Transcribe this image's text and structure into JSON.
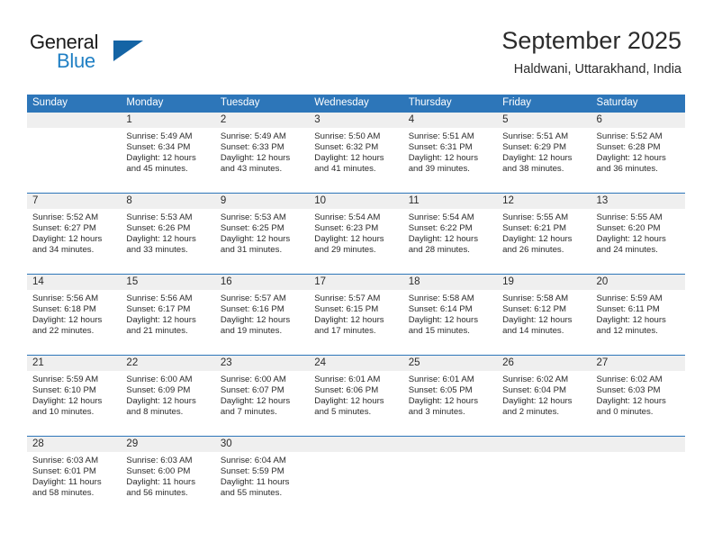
{
  "brand": {
    "name_part1": "General",
    "name_part2": "Blue",
    "flag_icon": "triangle-flag-icon"
  },
  "header": {
    "title": "September 2025",
    "subtitle": "Haldwani, Uttarakhand, India"
  },
  "theme": {
    "header_blue": "#2d76b9",
    "brand_blue": "#1f7fc4",
    "flag_blue": "#1464a5",
    "day_band_grey": "#efefef",
    "text": "#2b2b2b"
  },
  "weekdays": [
    "Sunday",
    "Monday",
    "Tuesday",
    "Wednesday",
    "Thursday",
    "Friday",
    "Saturday"
  ],
  "weeks": [
    [
      {
        "day": "",
        "empty": true
      },
      {
        "day": "1",
        "sunrise": "Sunrise: 5:49 AM",
        "sunset": "Sunset: 6:34 PM",
        "daylight": "Daylight: 12 hours and 45 minutes."
      },
      {
        "day": "2",
        "sunrise": "Sunrise: 5:49 AM",
        "sunset": "Sunset: 6:33 PM",
        "daylight": "Daylight: 12 hours and 43 minutes."
      },
      {
        "day": "3",
        "sunrise": "Sunrise: 5:50 AM",
        "sunset": "Sunset: 6:32 PM",
        "daylight": "Daylight: 12 hours and 41 minutes."
      },
      {
        "day": "4",
        "sunrise": "Sunrise: 5:51 AM",
        "sunset": "Sunset: 6:31 PM",
        "daylight": "Daylight: 12 hours and 39 minutes."
      },
      {
        "day": "5",
        "sunrise": "Sunrise: 5:51 AM",
        "sunset": "Sunset: 6:29 PM",
        "daylight": "Daylight: 12 hours and 38 minutes."
      },
      {
        "day": "6",
        "sunrise": "Sunrise: 5:52 AM",
        "sunset": "Sunset: 6:28 PM",
        "daylight": "Daylight: 12 hours and 36 minutes."
      }
    ],
    [
      {
        "day": "7",
        "sunrise": "Sunrise: 5:52 AM",
        "sunset": "Sunset: 6:27 PM",
        "daylight": "Daylight: 12 hours and 34 minutes."
      },
      {
        "day": "8",
        "sunrise": "Sunrise: 5:53 AM",
        "sunset": "Sunset: 6:26 PM",
        "daylight": "Daylight: 12 hours and 33 minutes."
      },
      {
        "day": "9",
        "sunrise": "Sunrise: 5:53 AM",
        "sunset": "Sunset: 6:25 PM",
        "daylight": "Daylight: 12 hours and 31 minutes."
      },
      {
        "day": "10",
        "sunrise": "Sunrise: 5:54 AM",
        "sunset": "Sunset: 6:23 PM",
        "daylight": "Daylight: 12 hours and 29 minutes."
      },
      {
        "day": "11",
        "sunrise": "Sunrise: 5:54 AM",
        "sunset": "Sunset: 6:22 PM",
        "daylight": "Daylight: 12 hours and 28 minutes."
      },
      {
        "day": "12",
        "sunrise": "Sunrise: 5:55 AM",
        "sunset": "Sunset: 6:21 PM",
        "daylight": "Daylight: 12 hours and 26 minutes."
      },
      {
        "day": "13",
        "sunrise": "Sunrise: 5:55 AM",
        "sunset": "Sunset: 6:20 PM",
        "daylight": "Daylight: 12 hours and 24 minutes."
      }
    ],
    [
      {
        "day": "14",
        "sunrise": "Sunrise: 5:56 AM",
        "sunset": "Sunset: 6:18 PM",
        "daylight": "Daylight: 12 hours and 22 minutes."
      },
      {
        "day": "15",
        "sunrise": "Sunrise: 5:56 AM",
        "sunset": "Sunset: 6:17 PM",
        "daylight": "Daylight: 12 hours and 21 minutes."
      },
      {
        "day": "16",
        "sunrise": "Sunrise: 5:57 AM",
        "sunset": "Sunset: 6:16 PM",
        "daylight": "Daylight: 12 hours and 19 minutes."
      },
      {
        "day": "17",
        "sunrise": "Sunrise: 5:57 AM",
        "sunset": "Sunset: 6:15 PM",
        "daylight": "Daylight: 12 hours and 17 minutes."
      },
      {
        "day": "18",
        "sunrise": "Sunrise: 5:58 AM",
        "sunset": "Sunset: 6:14 PM",
        "daylight": "Daylight: 12 hours and 15 minutes."
      },
      {
        "day": "19",
        "sunrise": "Sunrise: 5:58 AM",
        "sunset": "Sunset: 6:12 PM",
        "daylight": "Daylight: 12 hours and 14 minutes."
      },
      {
        "day": "20",
        "sunrise": "Sunrise: 5:59 AM",
        "sunset": "Sunset: 6:11 PM",
        "daylight": "Daylight: 12 hours and 12 minutes."
      }
    ],
    [
      {
        "day": "21",
        "sunrise": "Sunrise: 5:59 AM",
        "sunset": "Sunset: 6:10 PM",
        "daylight": "Daylight: 12 hours and 10 minutes."
      },
      {
        "day": "22",
        "sunrise": "Sunrise: 6:00 AM",
        "sunset": "Sunset: 6:09 PM",
        "daylight": "Daylight: 12 hours and 8 minutes."
      },
      {
        "day": "23",
        "sunrise": "Sunrise: 6:00 AM",
        "sunset": "Sunset: 6:07 PM",
        "daylight": "Daylight: 12 hours and 7 minutes."
      },
      {
        "day": "24",
        "sunrise": "Sunrise: 6:01 AM",
        "sunset": "Sunset: 6:06 PM",
        "daylight": "Daylight: 12 hours and 5 minutes."
      },
      {
        "day": "25",
        "sunrise": "Sunrise: 6:01 AM",
        "sunset": "Sunset: 6:05 PM",
        "daylight": "Daylight: 12 hours and 3 minutes."
      },
      {
        "day": "26",
        "sunrise": "Sunrise: 6:02 AM",
        "sunset": "Sunset: 6:04 PM",
        "daylight": "Daylight: 12 hours and 2 minutes."
      },
      {
        "day": "27",
        "sunrise": "Sunrise: 6:02 AM",
        "sunset": "Sunset: 6:03 PM",
        "daylight": "Daylight: 12 hours and 0 minutes."
      }
    ],
    [
      {
        "day": "28",
        "sunrise": "Sunrise: 6:03 AM",
        "sunset": "Sunset: 6:01 PM",
        "daylight": "Daylight: 11 hours and 58 minutes."
      },
      {
        "day": "29",
        "sunrise": "Sunrise: 6:03 AM",
        "sunset": "Sunset: 6:00 PM",
        "daylight": "Daylight: 11 hours and 56 minutes."
      },
      {
        "day": "30",
        "sunrise": "Sunrise: 6:04 AM",
        "sunset": "Sunset: 5:59 PM",
        "daylight": "Daylight: 11 hours and 55 minutes."
      },
      {
        "day": "",
        "empty": true
      },
      {
        "day": "",
        "empty": true
      },
      {
        "day": "",
        "empty": true
      },
      {
        "day": "",
        "empty": true
      }
    ]
  ]
}
